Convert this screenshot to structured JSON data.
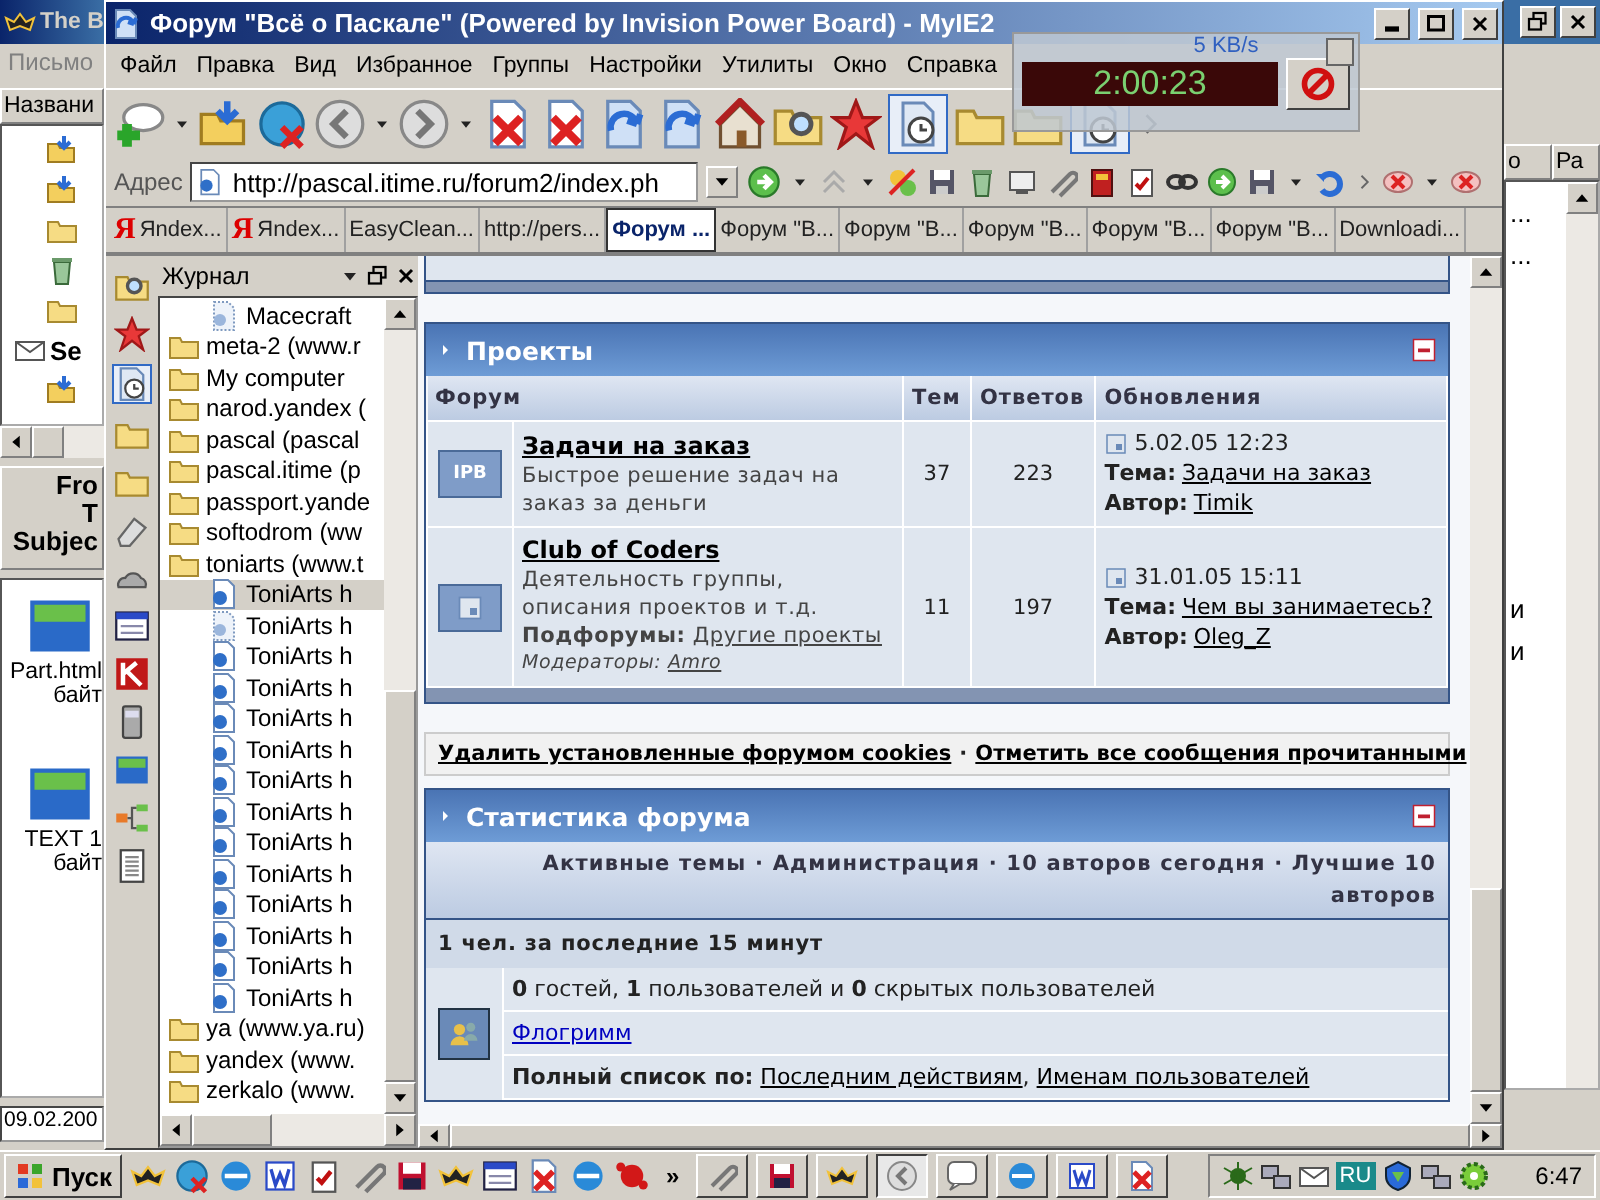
{
  "background_window": {
    "title": "The B",
    "menu": "Письмо",
    "column_header": "Названи",
    "tree_label": "Se",
    "message_header": [
      "Fro",
      "T",
      "Subjec"
    ],
    "attachments": [
      {
        "name": "Part.html",
        "size": "байт"
      },
      {
        "name": "TEXT 1",
        "size": "байт"
      }
    ],
    "date": "09.02.200",
    "right_headers": [
      "о",
      "Ра"
    ],
    "right_rows": [
      "...",
      "...",
      "и",
      "и"
    ]
  },
  "window": {
    "title": "Форум \"Всё о Паскале\" (Powered by Invision Power Board) - MyIE2"
  },
  "menu": [
    "Файл",
    "Правка",
    "Вид",
    "Избранное",
    "Группы",
    "Настройки",
    "Утилиты",
    "Окно",
    "Справка"
  ],
  "address_bar": {
    "label": "Адрес",
    "value": "http://pascal.itime.ru/forum2/index.ph"
  },
  "tabs": [
    {
      "label": "Яndex...",
      "favicon": "Я",
      "selected": false
    },
    {
      "label": "Яndex...",
      "favicon": "Я",
      "selected": false
    },
    {
      "label": "EasyClean...",
      "selected": false
    },
    {
      "label": "http://pers...",
      "selected": false
    },
    {
      "label": "Форум ...",
      "selected": true
    },
    {
      "label": "Форум \"В...",
      "selected": false
    },
    {
      "label": "Форум \"В...",
      "selected": false
    },
    {
      "label": "Форум \"В...",
      "selected": false
    },
    {
      "label": "Форум \"В...",
      "selected": false
    },
    {
      "label": "Форум \"В...",
      "selected": false
    },
    {
      "label": "Downloadi...",
      "selected": false
    }
  ],
  "net_meter": {
    "speed": "5 KB/s",
    "time": "2:00:23"
  },
  "sidebar": {
    "title": "Журнал",
    "items": [
      {
        "children": [
          {
            "label": "Macecraft",
            "kind": "link",
            "selected": false
          }
        ]
      },
      {
        "label": "meta-2 (www.r",
        "kind": "folder",
        "selected": false
      },
      {
        "label": "My computer",
        "kind": "folder",
        "selected": false
      },
      {
        "label": "narod.yandex (",
        "kind": "folder",
        "selected": false
      },
      {
        "label": "pascal (pascal",
        "kind": "folder",
        "selected": false
      },
      {
        "label": "pascal.itime (p",
        "kind": "folder",
        "selected": false
      },
      {
        "label": "passport.yande",
        "kind": "folder",
        "selected": false
      },
      {
        "label": "softodrom (ww",
        "kind": "folder",
        "selected": false
      },
      {
        "label": "toniarts (www.t",
        "kind": "folder",
        "selected": false,
        "children": [
          {
            "label": "ToniArts h",
            "kind": "page",
            "selected": true
          },
          {
            "label": "ToniArts h",
            "kind": "link",
            "selected": false
          },
          {
            "label": "ToniArts h",
            "kind": "page",
            "selected": false
          },
          {
            "label": "ToniArts h",
            "kind": "page",
            "selected": false
          },
          {
            "label": "ToniArts h",
            "kind": "page",
            "selected": false
          },
          {
            "label": "ToniArts h",
            "kind": "page",
            "selected": false
          },
          {
            "label": "ToniArts h",
            "kind": "page",
            "selected": false
          },
          {
            "label": "ToniArts h",
            "kind": "page",
            "selected": false
          },
          {
            "label": "ToniArts h",
            "kind": "page",
            "selected": false
          },
          {
            "label": "ToniArts h",
            "kind": "page",
            "selected": false
          },
          {
            "label": "ToniArts h",
            "kind": "page",
            "selected": false
          },
          {
            "label": "ToniArts h",
            "kind": "page",
            "selected": false
          },
          {
            "label": "ToniArts h",
            "kind": "page",
            "selected": false
          },
          {
            "label": "ToniArts h",
            "kind": "page",
            "selected": false
          }
        ]
      },
      {
        "label": "ya (www.ya.ru)",
        "kind": "folder",
        "selected": false
      },
      {
        "label": "yandex (www.",
        "kind": "folder",
        "selected": false
      },
      {
        "label": "zerkalo (www.",
        "kind": "folder",
        "selected": false
      }
    ]
  },
  "projects": {
    "title": "Проекты",
    "columns": [
      "Форум",
      "Тем",
      "Ответов",
      "Обновления"
    ],
    "rows": [
      {
        "icon_text": "IPB",
        "name": "Задачи на заказ",
        "description": "Быстрое решение задач на заказ за деньги",
        "topics": "37",
        "replies": "223",
        "date": "5.02.05 12:23",
        "topic_label": "Тема:",
        "topic": "Задачи на заказ",
        "author_label": "Автор:",
        "author": "Timik"
      },
      {
        "name": "Club of Coders",
        "description": "Деятельность группы, описания проектов и т.д.",
        "subforums_label": "Подфорумы:",
        "subforums": "Другие проекты",
        "moderators_label": "Модераторы:",
        "moderators": "Amro",
        "topics": "11",
        "replies": "197",
        "date": "31.01.05 15:11",
        "topic_label": "Тема:",
        "topic": "Чем вы занимаетесь?",
        "author_label": "Автор:",
        "author": "Oleg_Z"
      }
    ]
  },
  "board_links": [
    "Удалить установленные форумом cookies",
    "Отметить все сообщения прочитанными"
  ],
  "separator": "·",
  "stats": {
    "title": "Статистика форума",
    "links_line": "Активные темы · Администрация · 10 авторов сегодня · Лучшие 10 авторов",
    "online_header": "1 чел. за последние 15 минут",
    "counts": "**0** гостей, **1** пользователей и **0** скрытых пользователей",
    "users": [
      "Флогримм"
    ],
    "full_list_label": "Полный список по:",
    "full_list": [
      "Последним действиям",
      "Именам пользователей"
    ],
    "list_separator": ","
  },
  "taskbar": {
    "start": "Пуск",
    "more": "»",
    "lang": "RU",
    "clock": "6:47"
  }
}
